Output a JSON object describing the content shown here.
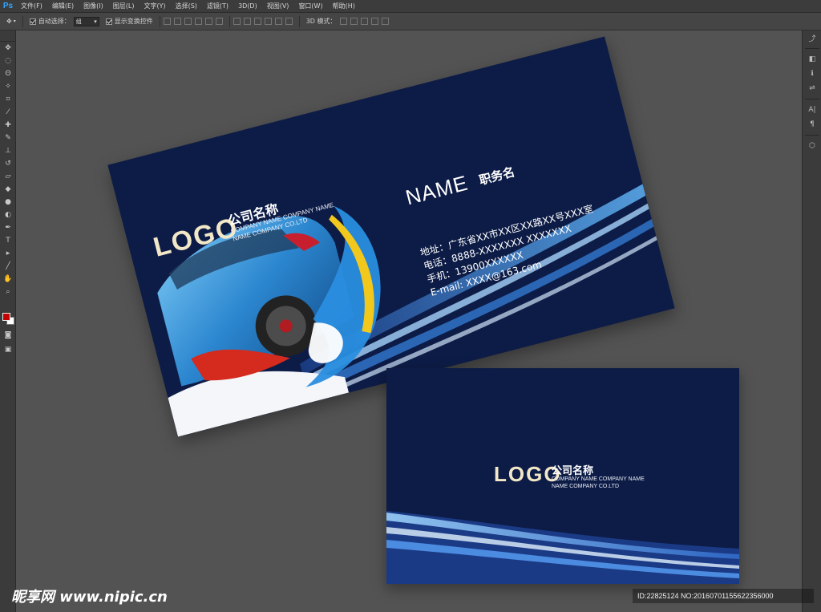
{
  "app": {
    "logo": "Ps"
  },
  "menu": [
    "文件(F)",
    "编辑(E)",
    "图像(I)",
    "图层(L)",
    "文字(Y)",
    "选择(S)",
    "滤镜(T)",
    "3D(D)",
    "视图(V)",
    "窗口(W)",
    "帮助(H)"
  ],
  "options": {
    "auto_select_label": "自动选择：",
    "auto_select_value": "组",
    "show_transform_label": "显示变换控件",
    "mode_label": "3D 模式："
  },
  "front_card": {
    "logo": "LOGO",
    "company_cn": "公司名称",
    "company_en_1": "COMPANY NAME COMPANY NAME",
    "company_en_2": "NAME COMPANY CO.LTD",
    "name": "NAME",
    "title": "职务名",
    "address": "地址：广东省XX市XX区XX路XX号XXX室",
    "phone": "电话：8888-XXXXXXX   XXXXXXX",
    "mobile": "手机：13900XXXXXX",
    "email": "E-mail: XXXX@163.com"
  },
  "back_card": {
    "logo": "LOGO",
    "company_cn": "公司名称",
    "company_en_1": "COMPANY NAME COMPANY NAME",
    "company_en_2": "NAME COMPANY CO.LTD"
  },
  "watermark": {
    "site": "昵享网 www.nipic.cn",
    "id_text": "ID:22825124 NO:20160701155622356000"
  },
  "colors": {
    "card_bg": "#0d1c46",
    "logo_gold": "#f2e7c7",
    "accent_blue": "#2f8fd8"
  }
}
